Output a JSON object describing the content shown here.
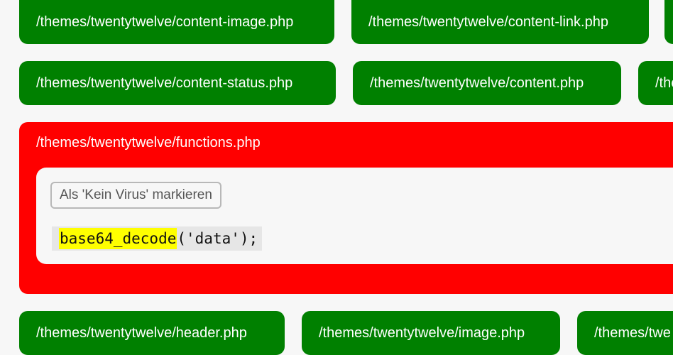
{
  "colors": {
    "ok": "#008000",
    "infected": "#ff0000",
    "highlight": "#ffff00",
    "card": "#f7f7f7"
  },
  "files": {
    "row1": [
      "/themes/twentytwelve/content-image.php",
      "/themes/twentytwelve/content-link.php"
    ],
    "row2": [
      "/themes/twentytwelve/content-status.php",
      "/themes/twentytwelve/content.php",
      "/the"
    ],
    "row4": [
      "/themes/twentytwelve/header.php",
      "/themes/twentytwelve/image.php",
      "/themes/twe"
    ]
  },
  "infected_file": {
    "path": "/themes/twentytwelve/functions.php",
    "mark_button": "Als 'Kein Virus' markieren",
    "code_match": "base64_decode",
    "code_rest": "('data');"
  }
}
